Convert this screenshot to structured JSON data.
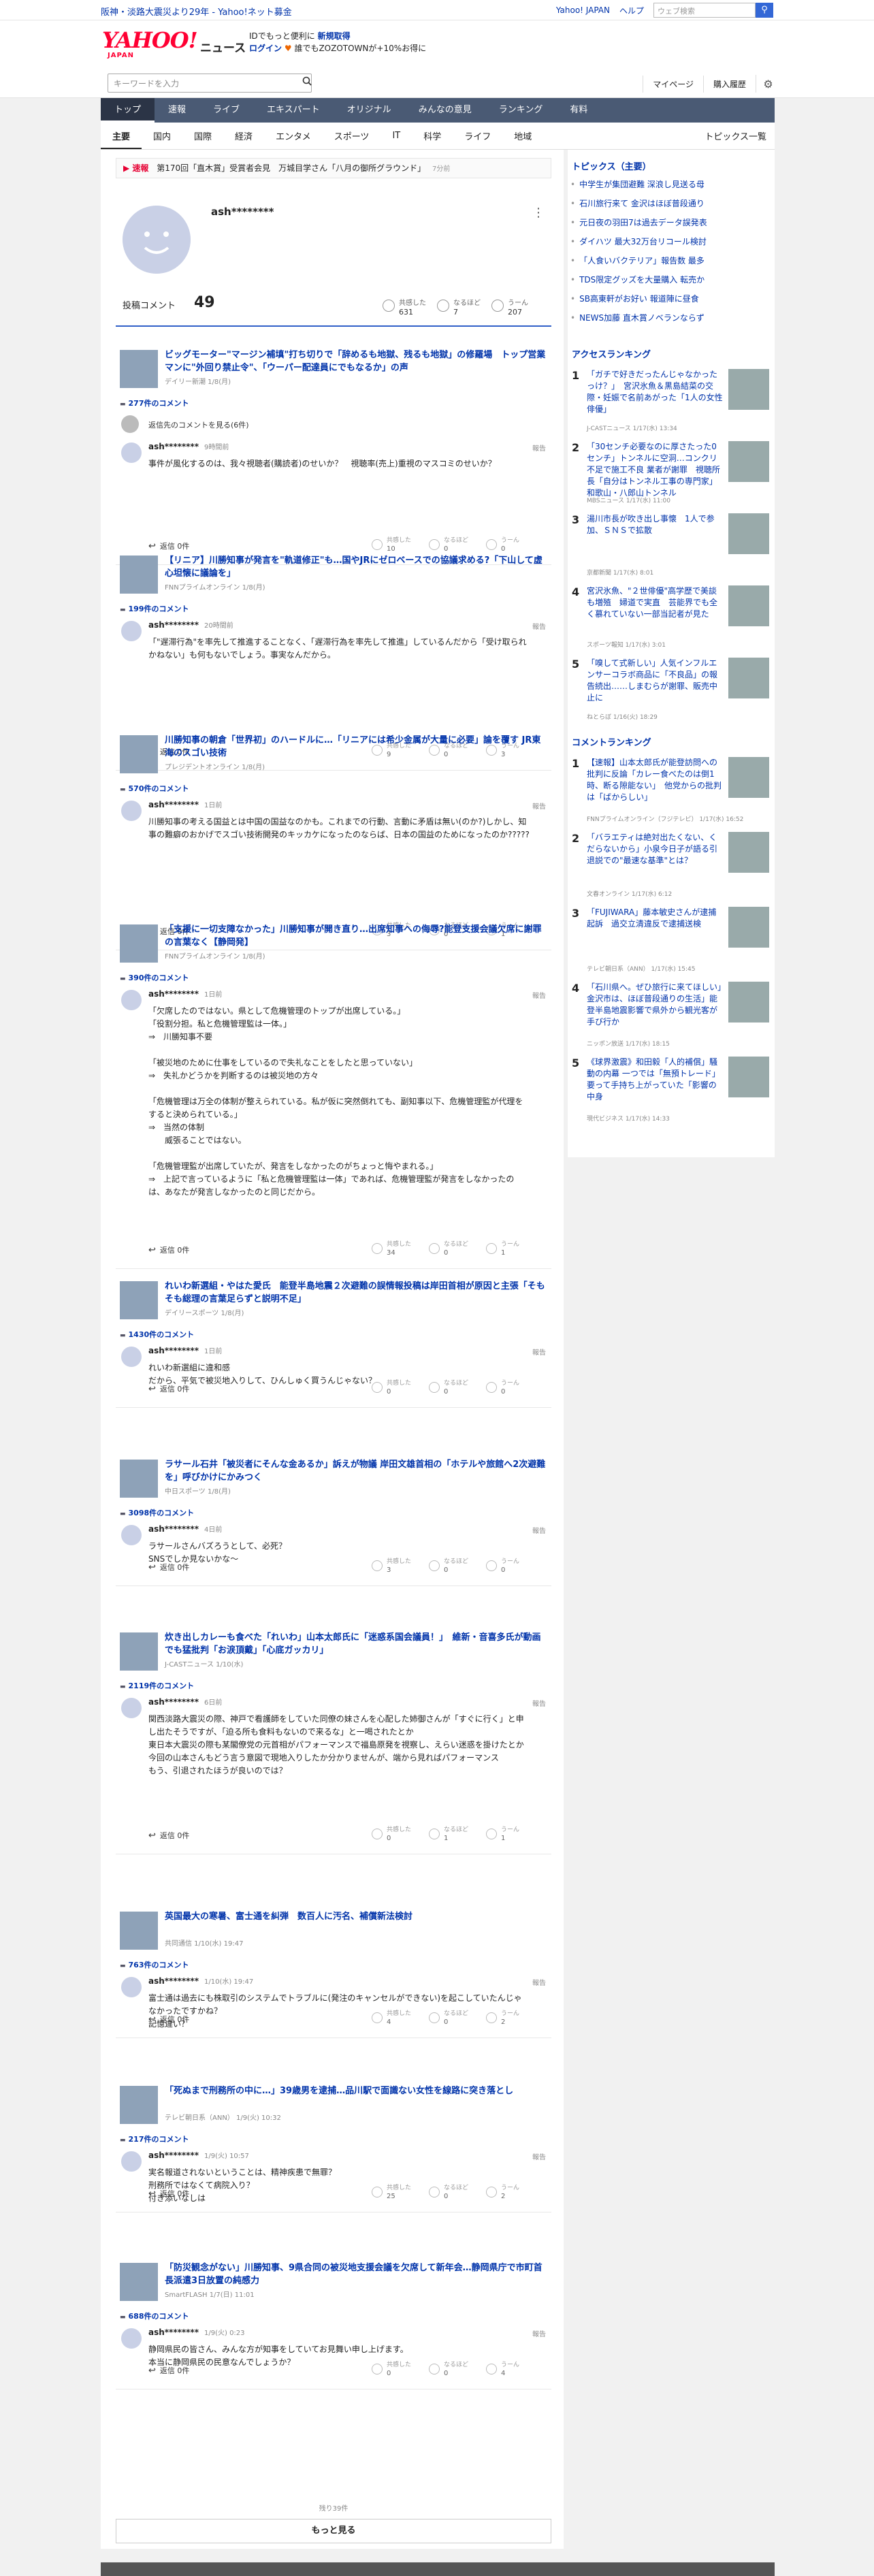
{
  "topbar": {
    "notice": "阪神・淡路大震災より29年 - Yahoo!ネット募金",
    "links": [
      "Yahoo! JAPAN",
      "ヘルプ"
    ],
    "search_placeholder": "ウェブ検索"
  },
  "header": {
    "logo_main": "YAHOO!",
    "logo_sub": "JAPAN",
    "logo_news": "ニュース",
    "promo_line1_pre": "IDでもっと便利に",
    "promo_line1_link": "新規取得",
    "promo_line2_pre": "ログイン",
    "promo_line2_post": "誰でもZOZOTOWNが+10%お得に"
  },
  "search": {
    "placeholder": "キーワードを入力",
    "mypage": "マイページ",
    "purchase": "購入履歴"
  },
  "nav": [
    "トップ",
    "速報",
    "ライブ",
    "エキスパート",
    "オリジナル",
    "みんなの意見",
    "ランキング",
    "有料"
  ],
  "subnav": [
    "主要",
    "国内",
    "国際",
    "経済",
    "エンタメ",
    "スポーツ",
    "IT",
    "科学",
    "ライフ",
    "地域"
  ],
  "subnav_right": "トピックス一覧",
  "breaking": {
    "tag": "速報",
    "text": "第170回「直木賞」受賞者会見　万城目学さん「八月の御所グラウンド」",
    "ago": "7分前"
  },
  "profile": {
    "name": "ash********"
  },
  "stats": {
    "label": "投稿コメント",
    "count": "49",
    "reacts": [
      {
        "label": "共感した",
        "n": "631"
      },
      {
        "label": "なるほど",
        "n": "7"
      },
      {
        "label": "うーん",
        "n": "207"
      }
    ]
  },
  "articles": [
    {
      "title": "ビッグモーター\"マージン補填\"打ち切りで「辞めるも地獄、残るも地獄」の修羅場　トップ営業マンに\"外回り禁止令\"、「ウーパー配達員にでもなるか」の声",
      "src": "デイリー新潮 1/8(月)",
      "count": "277件のコメント",
      "replies_toggle": "返信先のコメントを見る(6件)",
      "user": "ash********",
      "time": "9時間前",
      "body": "事件が風化するのは、我々視聴者(購読者)のせいか？　視聴率(売上)重視のマスコミのせいか？",
      "reply": "返信 0件",
      "r": [
        "10",
        "0",
        "0"
      ]
    },
    {
      "title": "【リニア】川勝知事が発言を\"軌道修正\"も…国やJRにゼロベースでの協議求める?「下山して虚心坦懐に議論を」",
      "src": "FNNプライムオンライン 1/8(月)",
      "count": "199件のコメント",
      "user": "ash********",
      "time": "20時間前",
      "body": "「\"遅滞行為\"を率先して推進することなく、「遅滞行為を率先して推進」しているんだから「受け取られかねない」も何もないでしょう。事実なんだから。",
      "reply": "返信 0件",
      "r": [
        "9",
        "0",
        "3"
      ]
    },
    {
      "title": "川勝知事の朝倉「世界初」のハードルに…「リニアには希少金属が大量に必要」論を覆す JR東海のスゴい技術",
      "src": "プレジデントオンライン 1/8(月)",
      "count": "570件のコメント",
      "user": "ash********",
      "time": "1日前",
      "body": "川勝知事の考える国益とは中国の国益なのかも。これまでの行動、言動に矛盾は無い(のか?)しかし、知事の難癖のおかげでスゴい技術開発のキッカケになったのならば、日本の国益のためになったのか?????",
      "reply": "返信 0件",
      "r": [
        "3",
        "0",
        "1"
      ]
    },
    {
      "title": "「支援に一切支障なかった」川勝知事が開き直り…出席知事への侮辱?能登支援会議欠席に謝罪の言葉なく【静岡発】",
      "src": "FNNプライムオンライン 1/8(月)",
      "count": "390件のコメント",
      "user": "ash********",
      "time": "1日前",
      "body": "「欠席したのではない。県として危機管理のトップが出席している。」\n「役割分担。私と危機管理監は一体。」\n⇒　川勝知事不要\n\n「被災地のために仕事をしているので失礼なことをしたと思っていない」\n⇒　失礼かどうかを判断するのは被災地の方々\n\n「危機管理は万全の体制が整えられている。私が仮に突然倒れても、副知事以下、危機管理監が代理をすると決められている。」\n⇒　当然の体制\n　　威張ることではない。\n\n「危機管理監が出席していたが、発言をしなかったのがちょっと悔やまれる。」\n⇒　上記で言っているように「私と危機管理監は一体」であれば、危機管理監が発言をしなかったのは、あなたが発言しなかったのと同じだから。",
      "reply": "返信 0件",
      "r": [
        "34",
        "0",
        "1"
      ]
    },
    {
      "title": "れいわ新選組・やはた愛氏　能登半島地震２次避難の誤情報投稿は岸田首相が原因と主張「そもそも総理の言葉足らずと説明不足」",
      "src": "デイリースポーツ 1/8(月)",
      "count": "1430件のコメント",
      "user": "ash********",
      "time": "1日前",
      "body": "れいわ新選組に違和感\nだから、平気で被災地入りして、ひんしゅく買うんじゃない？",
      "reply": "返信 0件",
      "r": [
        "0",
        "0",
        "0"
      ]
    },
    {
      "title": "ラサール石井「被災者にそんな金あるか」訴えが物議 岸田文雄首相の「ホテルや旅館へ2次避難を」呼びかけにかみつく",
      "src": "中日スポーツ 1/8(月)",
      "count": "3098件のコメント",
      "user": "ash********",
      "time": "4日前",
      "body": "ラサールさんバズろうとして、必死？\nSNSでしか見ないかな～",
      "reply": "返信 0件",
      "r": [
        "3",
        "0",
        "0"
      ]
    },
    {
      "title": "炊き出しカレーも食べた「れいわ」山本太郎氏に「迷惑系国会議員！」　維新・音喜多氏が動画でも猛批判「お涙頂戴」「心底ガッカリ」",
      "src": "J-CASTニュース 1/10(水)",
      "count": "2119件のコメント",
      "user": "ash********",
      "time": "6日前",
      "body": "関西淡路大震災の際、神戸で看護師をしていた同僚の妹さんを心配した姉御さんが「すぐに行く」と申し出たそうですが、「迫る所も食料もないので来るな」と一喝されたとか\n東日本大震災の際も某閣僚党の元首相がパフォーマンスで福島原発を視察し、えらい迷惑を掛けたとか\n今回の山本さんもどう言う意図で現地入りしたか分かりませんが、端から見ればパフォーマンス\nもう、引退されたほうが良いのでは？",
      "reply": "返信 0件",
      "r": [
        "0",
        "1",
        "1"
      ]
    },
    {
      "title": "英国最大の寒暑、富士通を糾弾　数百人に汚名、補償新法検討",
      "src": "共同通信 1/10(水) 19:47",
      "count": "763件のコメント",
      "user": "ash********",
      "time": "1/10(水) 19:47",
      "body": "富士通は過去にも株取引のシステムでトラブルに(発注のキャンセルができない)を起こしていたんじゃなかったですかね？\n記憶違い？",
      "reply": "返信 0件",
      "r": [
        "4",
        "0",
        "2"
      ]
    },
    {
      "title": "「死ぬまで刑務所の中に…」39歳男を逮捕…品川駅で面識ない女性を線路に突き落とし",
      "src": "テレビ朝日系（ANN） 1/9(火) 10:32",
      "count": "217件のコメント",
      "user": "ash********",
      "time": "1/9(火) 10:57",
      "body": "実名報道されないということは、精神疾患で無罪？\n刑務所ではなくて病院入り？\n付き添いなしは",
      "reply": "返信 0件",
      "r": [
        "25",
        "0",
        "2"
      ]
    },
    {
      "title": "「防災観念がない」川勝知事、9県合同の被災地支援会議を欠席して新年会…静岡県庁で市町首長派遣3日放置の純感力",
      "src": "SmartFLASH 1/7(日) 11:01",
      "count": "688件のコメント",
      "user": "ash********",
      "time": "1/9(火) 0:23",
      "body": "静岡県民の皆さん、みんな方が知事をしていてお見舞い申し上げます。\n本当に静岡県民の民意なんでしょうか？",
      "reply": "返信 0件",
      "r": [
        "0",
        "0",
        "4"
      ]
    }
  ],
  "react_labels": [
    "共感した",
    "なるほど",
    "うーん"
  ],
  "report_label": "報告",
  "remain": "残り39件",
  "more": "もっと見る",
  "side": {
    "topics_title": "トピックス（主要）",
    "topics": [
      "中学生が集団避難 深浪し見送る母",
      "石川旅行来て 金沢はほぼ普段通り",
      "元日夜の羽田7は過去データ誤発表",
      "ダイハツ 最大32万台リコール検討",
      "「人食いバクテリア」報告数 最多",
      "TDS限定グッズを大量購入 転売か",
      "SB高東軒がお好い 報道陣に昼食",
      "NEWS加藤 直木賞ノベランならず"
    ],
    "access_title": "アクセスランキング",
    "access": [
      {
        "t": "「ガチで好きだったんじゃなかったっけ？」　宮沢氷魚＆黒島結菜の交際・妊娠で名前あがった「1人の女性俳優」",
        "s": "J-CASTニュース 1/17(水) 13:34"
      },
      {
        "t": "「30センチ必要なのに厚さたった0センチ」トンネルに空洞…コンクリ不足で施工不良 業者が謝罪　視聴所長「自分はトンネル工事の専門家」和歌山・八郎山トンネル",
        "s": "MBSニュース 1/17(水) 11:00"
      },
      {
        "t": "湯川市長が吹き出し事懐　1人で参加、ＳＮＳで拡散",
        "s": "京都新聞 1/17(水) 8:01"
      },
      {
        "t": "宮沢氷魚、\"２世俳優\"高学歴で美談も増殖　婦道で実直　芸能界でも全く慕れていない一部当記者が見た",
        "s": "スポーツ報知 1/17(水) 3:01"
      },
      {
        "t": "「嗅して式新しい」人気インフルエンサーコラボ商品に「不良品」の報告続出……しまむらが謝罪、販売中止に",
        "s": "ねとらぼ 1/16(火) 18:29"
      }
    ],
    "comment_title": "コメントランキング",
    "comments": [
      {
        "t": "【速報】山本太郎氏が能登訪問への批判に反論「カレー食べたのは倒1時、断る隙能ない」　他党からの批判は「ばからしい」",
        "s": "FNNプライムオンライン（フジテレビ） 1/17(水) 16:52"
      },
      {
        "t": "「バラエティは絶対出たくない、くだらないから」小泉今日子が語る引退説での\"最速な基準\"とは？",
        "s": "文春オンライン 1/17(水) 6:12"
      },
      {
        "t": "「FUJIWARA」藤本敏史さんが逮捕起訴　過交立清違反で逮捕送検",
        "s": "テレビ朝日系（ANN） 1/17(水) 15:45"
      },
      {
        "t": "「石川県へ。ぜひ旅行に来てほしい」金沢市は、ほぼ普段通りの生活」能登半島地震影響で県外から観光客が手び行か",
        "s": "ニッポン放送 1/17(水) 18:15"
      },
      {
        "t": "《球界激震》和田毅「人的補償」騒動の内幕 一つでは「無預トレード」要って手持ち上がっていた「影響の中身",
        "s": "現代ビジネス 1/17(水) 14:33"
      }
    ]
  },
  "colors": {
    "nav_bg": "#4a5a74",
    "link": "#0033aa",
    "accent": "#3060c8",
    "breaking": "#e60033"
  }
}
